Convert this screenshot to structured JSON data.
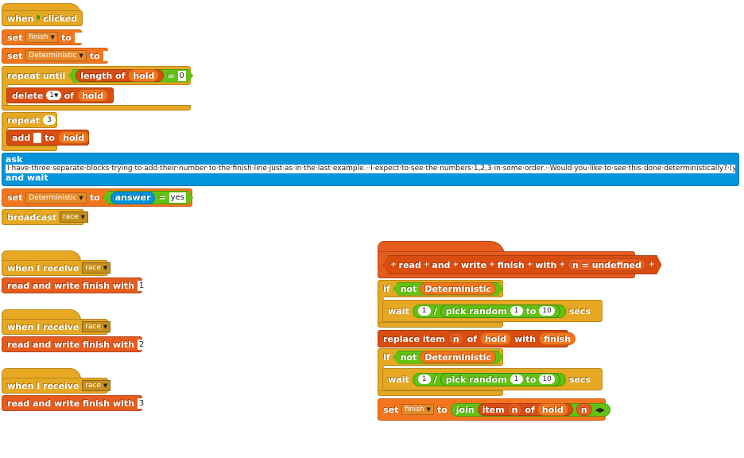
{
  "script_main": {
    "hat": {
      "when": "when",
      "clicked": "clicked",
      "icon": "green-flag-icon"
    },
    "set1": {
      "set": "set",
      "var": "finish",
      "to": "to"
    },
    "set2": {
      "set": "set",
      "var": "Deterministic",
      "to": "to"
    },
    "repeat_until": {
      "label": "repeat until",
      "length_of": "length of",
      "list": "hold",
      "equals": "=",
      "value": "0"
    },
    "delete": {
      "label": "delete",
      "index": "1",
      "of": "of",
      "list": "hold"
    },
    "repeat": {
      "label": "repeat",
      "count": "3"
    },
    "add": {
      "add": "add",
      "to": "to",
      "list": "hold"
    },
    "ask": {
      "ask": "ask",
      "question": "I·have·three·separate·blocks·trying·to·add·their·number·to·the·finish·line·just·as·in·the·last·example.··I·expect·to·see·the·numbers·1,2,3·in·some·order.··Would·you·like·to·see·this·done·deterministically?·(yes/no)",
      "and_wait": "and wait"
    },
    "set3": {
      "set": "set",
      "var": "Deterministic",
      "to": "to",
      "answer": "answer",
      "equals": "=",
      "value": "yes"
    },
    "broadcast": {
      "label": "broadcast",
      "message": "race"
    }
  },
  "receivers": [
    {
      "when": "when I receive",
      "message": "race",
      "action": "read and write finish with",
      "value": "1"
    },
    {
      "when": "when I receive",
      "message": "race",
      "action": "read and write finish with",
      "value": "2"
    },
    {
      "when": "when I receive",
      "message": "race",
      "action": "read and write finish with",
      "value": "3"
    }
  ],
  "definition": {
    "header": {
      "w1": "read",
      "w2": "and",
      "w3": "write",
      "w4": "finish",
      "w5": "with",
      "param": "n = undefined"
    },
    "if1": {
      "if": "if",
      "not": "not",
      "var": "Deterministic"
    },
    "wait1": {
      "wait": "wait",
      "num": "1",
      "div": "/",
      "pick": "pick random",
      "from": "1",
      "to": "to",
      "to_val": "10",
      "secs": "secs"
    },
    "replace": {
      "label": "replace item",
      "index": "n",
      "of": "of",
      "list": "hold",
      "with": "with",
      "var": "finish"
    },
    "if2": {
      "if": "if",
      "not": "not",
      "var": "Deterministic"
    },
    "wait2": {
      "wait": "wait",
      "num": "1",
      "div": "/",
      "pick": "pick random",
      "from": "1",
      "to": "to",
      "to_val": "10",
      "secs": "secs"
    },
    "setjoin": {
      "set": "set",
      "var": "finish",
      "to": "to",
      "join": "join",
      "item": "item",
      "index": "n",
      "of": "of",
      "list": "hold",
      "param": "n"
    }
  },
  "colors": {
    "control": "#e6a822",
    "variables": "#f3761d",
    "lists": "#d94d11",
    "sensing": "#0494dc",
    "operators": "#62c213",
    "custom": "#e65c1e"
  }
}
